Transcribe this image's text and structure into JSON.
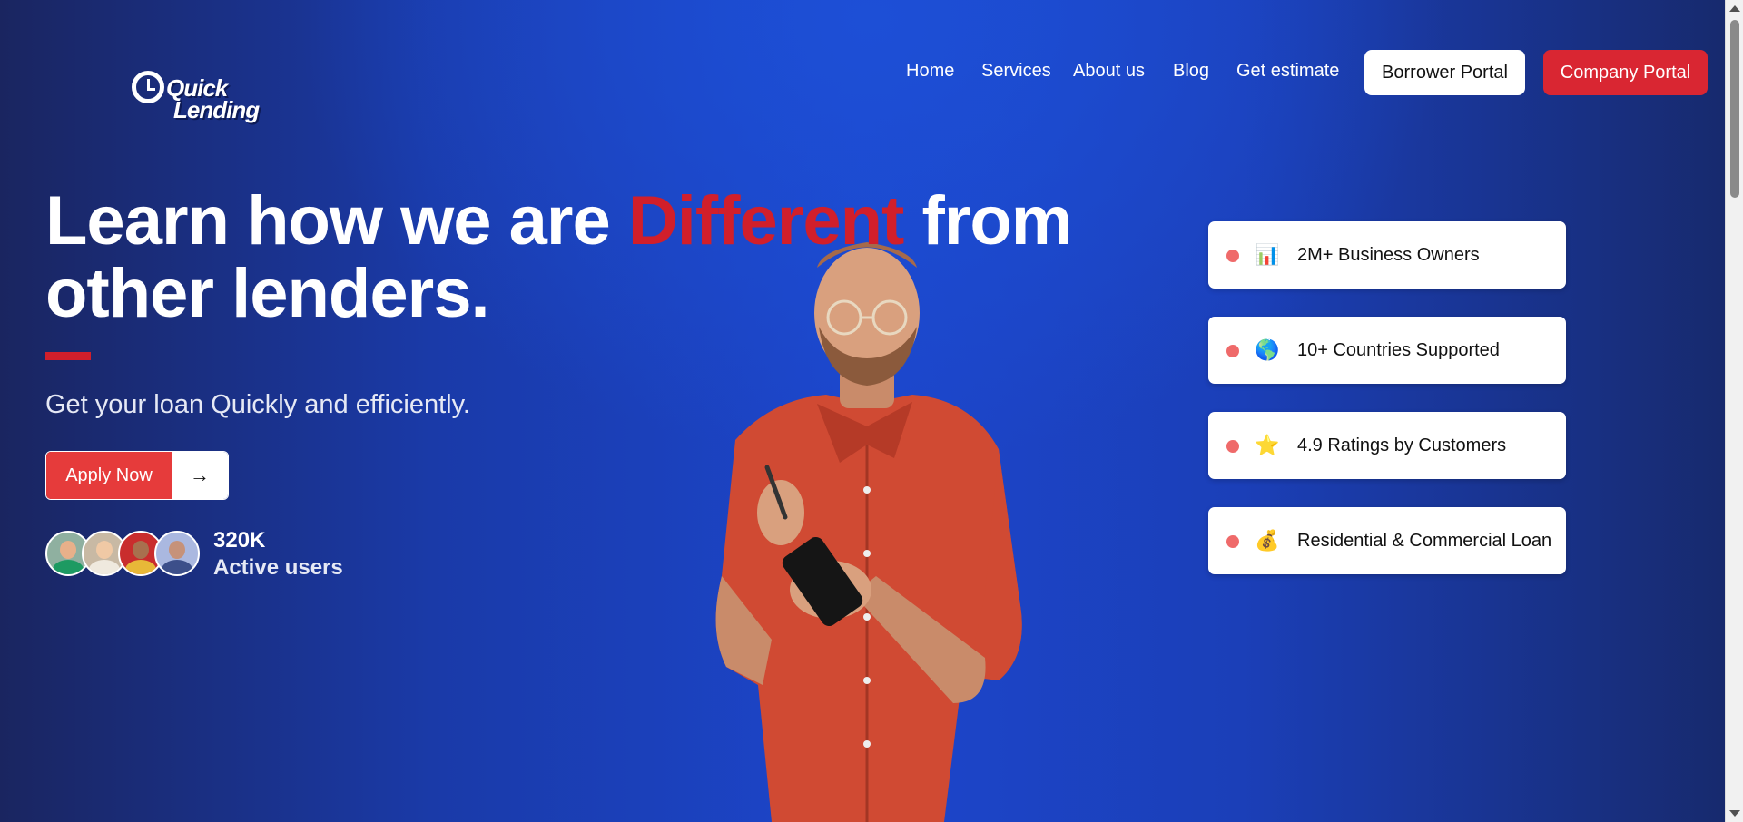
{
  "brand": {
    "logo_word1": "Quick",
    "logo_word2": "Lending"
  },
  "nav": {
    "links": [
      "Home",
      "Services",
      "About us",
      "Blog",
      "Get estimate"
    ],
    "borrower_portal": "Borrower Portal",
    "company_portal": "Company Portal"
  },
  "hero": {
    "headline_part1": "Learn how we are ",
    "headline_highlight": "Different",
    "headline_part2": " from other lenders.",
    "subtitle": "Get your loan Quickly and efficiently.",
    "apply_label": "Apply Now",
    "apply_arrow": "→",
    "users_count": "320K",
    "users_label": "Active users"
  },
  "stats": [
    {
      "icon": "bar-chart-icon",
      "glyph": "📊",
      "label": "2M+ Business Owners"
    },
    {
      "icon": "globe-icon",
      "glyph": "🌎",
      "label": "10+ Countries Supported"
    },
    {
      "icon": "star-icon",
      "glyph": "⭐",
      "label": "4.9 Ratings by Customers"
    },
    {
      "icon": "money-bag-icon",
      "glyph": "💰",
      "label": "Residential & Commercial Loan"
    }
  ],
  "colors": {
    "accent_red": "#d11f2b",
    "button_red": "#e63b3b",
    "background_blue": "#1c46cc",
    "dot_red": "#ef6a6a"
  }
}
